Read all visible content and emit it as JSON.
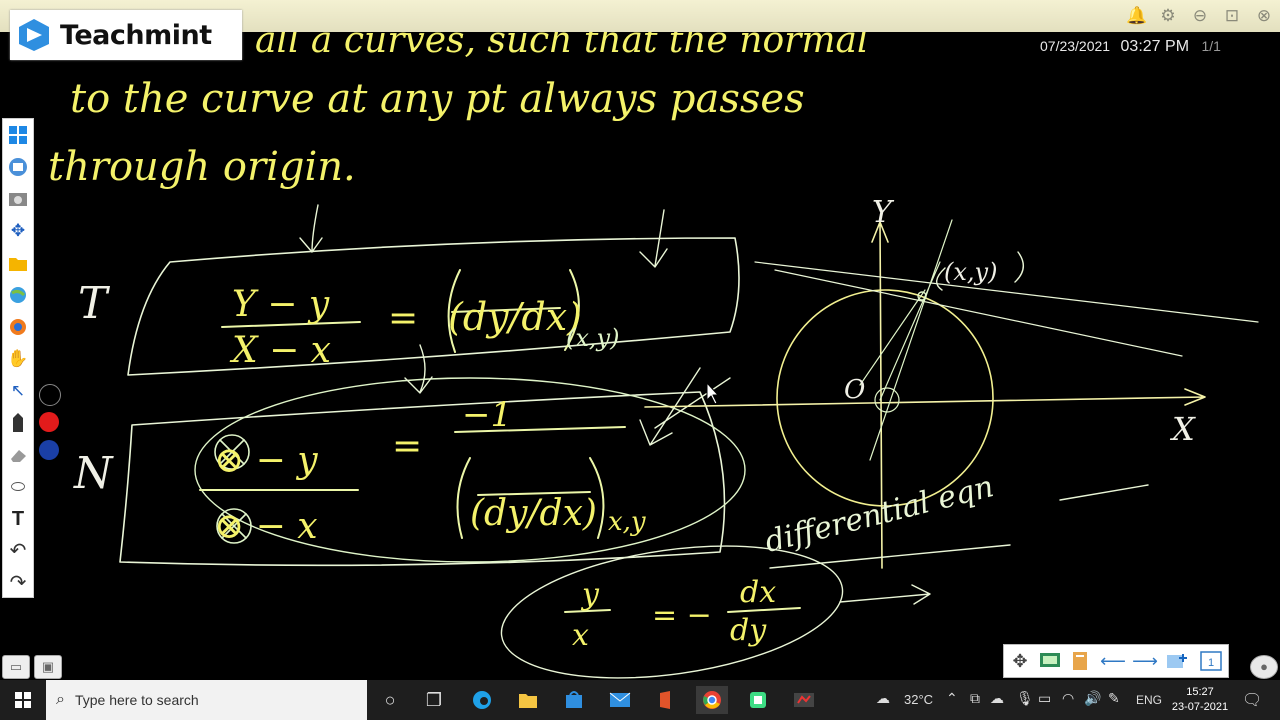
{
  "logo": {
    "name": "Teachmint"
  },
  "header": {
    "date": "07/23/2021",
    "time": "03:27 PM",
    "page": "1/1"
  },
  "board": {
    "line1": "all a curves, such that the normal",
    "line2": "to the curve at any pt always passes",
    "line3": "through origin.",
    "t_label": "T",
    "n_label": "N",
    "eq1_left_num": "Y − y",
    "eq1_left_den": "X − x",
    "eq1_eq": "=",
    "eq1_right": "(dy/dx)",
    "eq1_sub": "(x,y)",
    "eq2_left_num": "⊗ − y",
    "eq2_left_den": "⊗ − x",
    "eq2_eq": "=",
    "eq2_right_num": "−1",
    "eq2_right_den": "(dy/dx)",
    "eq2_sub": "x,y",
    "eq3_left_num": "y",
    "eq3_left_den": "x",
    "eq3_eq": "= −",
    "eq3_right_num": "dx",
    "eq3_right_den": "dy",
    "diag_y": "Y",
    "diag_x": "X",
    "diag_o": "O",
    "diag_point": "(x,y)",
    "note": "differential eqn"
  },
  "colors": {
    "chalk_yellow": "#f4f26a",
    "chalk_green": "#d2f0b4",
    "chalk_white": "#f0f0e6"
  },
  "left_toolbar": {
    "tools": [
      "windows-icon",
      "app-icon",
      "screenshot-icon",
      "move-icon",
      "folder-icon",
      "globe-icon",
      "browser-icon",
      "hand-icon",
      "pointer-icon",
      "pen-icon",
      "eraser-icon",
      "shape-icon",
      "text-icon",
      "undo-icon",
      "redo-icon"
    ],
    "swatch_colors": [
      "#000000",
      "#e31b1b",
      "#1a3fa6"
    ]
  },
  "nav_toolbar": {
    "buttons": [
      "move-icon",
      "presentation-icon",
      "pages-icon",
      "prev-page-icon",
      "next-page-icon",
      "add-page-icon",
      "page-icon"
    ],
    "page_number": "1"
  },
  "taskbar": {
    "search_placeholder": "Type here to search",
    "weather": "32°C",
    "language": "ENG",
    "clock_time": "15:27",
    "clock_date": "23-07-2021",
    "apps": [
      "cortana-icon",
      "task-view-icon",
      "edge-icon",
      "file-explorer-icon",
      "store-icon",
      "mail-icon",
      "office-icon",
      "chrome-icon",
      "android-studio-icon",
      "teachmint-icon"
    ]
  }
}
